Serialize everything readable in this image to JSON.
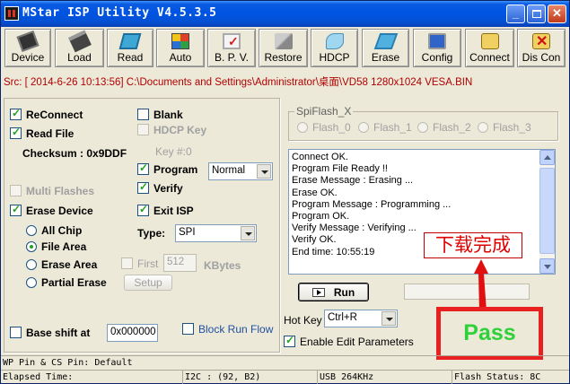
{
  "window": {
    "title": "MStar ISP Utility V4.5.3.5"
  },
  "toolbar": [
    {
      "label": "Device",
      "icon": "chip-icon"
    },
    {
      "label": "Load",
      "icon": "chip-load-icon"
    },
    {
      "label": "Read",
      "icon": "read-board-icon"
    },
    {
      "label": "Auto",
      "icon": "auto-color-icon"
    },
    {
      "label": "B. P. V.",
      "icon": "checkmark-icon"
    },
    {
      "label": "Restore",
      "icon": "restore-icon"
    },
    {
      "label": "HDCP",
      "icon": "hdcp-key-icon"
    },
    {
      "label": "Erase",
      "icon": "eraser-icon"
    },
    {
      "label": "Config",
      "icon": "monitor-config-icon"
    },
    {
      "label": "Connect",
      "icon": "connect-plug-icon"
    },
    {
      "label": "Dis Con",
      "icon": "disconnect-icon"
    }
  ],
  "source": {
    "text": "Src: [ 2014-6-26 10:13:56]  C:\\Documents and Settings\\Administrator\\桌面\\VD58 1280x1024 VESA.BIN"
  },
  "options": {
    "reconnect": {
      "label": "ReConnect",
      "checked": true
    },
    "read_file": {
      "label": "Read File",
      "checked": true
    },
    "checksum": "Checksum : 0x9DDF",
    "blank": {
      "label": "Blank",
      "checked": false
    },
    "hdcp_key": {
      "label": "HDCP Key",
      "checked": false
    },
    "key_index": "Key #:0",
    "program": {
      "label": "Program",
      "checked": true
    },
    "program_mode": "Normal",
    "verify": {
      "label": "Verify",
      "checked": true
    },
    "multi_flashes": {
      "label": "Multi Flashes",
      "checked": false
    },
    "erase_device": {
      "label": "Erase Device",
      "checked": true
    },
    "exit_isp": {
      "label": "Exit ISP",
      "checked": true
    },
    "type_label": "Type:",
    "type_value": "SPI",
    "erase_modes": [
      {
        "label": "All Chip",
        "selected": false
      },
      {
        "label": "File Area",
        "selected": true
      },
      {
        "label": "Erase Area",
        "selected": false
      },
      {
        "label": "Partial Erase",
        "selected": false
      }
    ],
    "first": {
      "label": "First",
      "checked": false
    },
    "first_value": "512",
    "kbytes": "KBytes",
    "setup_label": "Setup",
    "base_shift": {
      "label": "Base shift at",
      "checked": false
    },
    "base_shift_value": "0x000000",
    "block_run_flow": {
      "label": "Block Run Flow",
      "checked": false
    }
  },
  "spiflash": {
    "title": "SpiFlash_X",
    "options": [
      "Flash_0",
      "Flash_1",
      "Flash_2",
      "Flash_3"
    ]
  },
  "log": [
    "Connect OK.",
    "Program File Ready !!",
    "Erase Message : Erasing ...",
    "Erase OK.",
    "Program Message : Programming ...",
    "Program OK.",
    "Verify Message : Verifying ...",
    "Verify OK.",
    "End time: 10:55:19"
  ],
  "run_label": "Run",
  "hotkey": {
    "label": "Hot Key",
    "value": "Ctrl+R"
  },
  "enable_edit": {
    "label": "Enable Edit Parameters",
    "checked": true
  },
  "annotations": {
    "download_complete": "下载完成",
    "pass": "Pass",
    "colors": {
      "annotation_red": "#e00000",
      "pass_green": "#2fd03a"
    }
  },
  "status": {
    "pins": "WP Pin & CS Pin: Default",
    "elapsed": "Elapsed Time:",
    "i2c": "I2C :  (92, B2)",
    "usb": "USB  264KHz",
    "flash_status": "Flash Status: 8C"
  }
}
